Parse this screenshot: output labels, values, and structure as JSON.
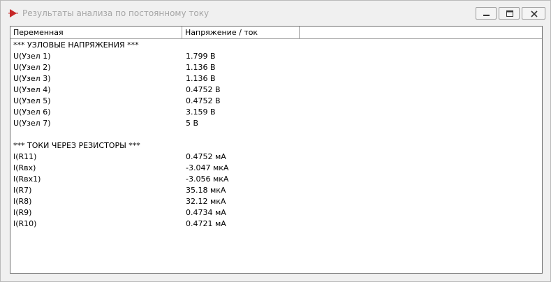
{
  "window": {
    "title": "Результаты анализа по постоянному току"
  },
  "table": {
    "columns": [
      "Переменная",
      "Напряжение / ток",
      ""
    ],
    "rows": [
      {
        "var": "*** УЗЛОВЫЕ НАПРЯЖЕНИЯ ***",
        "val": ""
      },
      {
        "var": "U(Узел 1)",
        "val": "1.799 В"
      },
      {
        "var": "U(Узел 2)",
        "val": "1.136 В"
      },
      {
        "var": "U(Узел 3)",
        "val": "1.136 В"
      },
      {
        "var": "U(Узел 4)",
        "val": "0.4752 В"
      },
      {
        "var": "U(Узел 5)",
        "val": "0.4752 В"
      },
      {
        "var": "U(Узел 6)",
        "val": "3.159 В"
      },
      {
        "var": "U(Узел 7)",
        "val": "5 В"
      },
      {
        "var": "",
        "val": ""
      },
      {
        "var": "*** ТОКИ ЧЕРЕЗ РЕЗИСТОРЫ ***",
        "val": ""
      },
      {
        "var": "I(R11)",
        "val": "0.4752 мА"
      },
      {
        "var": "I(Rвх)",
        "val": "-3.047 мкА"
      },
      {
        "var": "I(Rвх1)",
        "val": "-3.056 мкА"
      },
      {
        "var": "I(R7)",
        "val": "35.18 мкА"
      },
      {
        "var": "I(R8)",
        "val": "32.12 мкА"
      },
      {
        "var": "I(R9)",
        "val": "0.4734 мА"
      },
      {
        "var": "I(R10)",
        "val": "0.4721 мА"
      }
    ]
  }
}
